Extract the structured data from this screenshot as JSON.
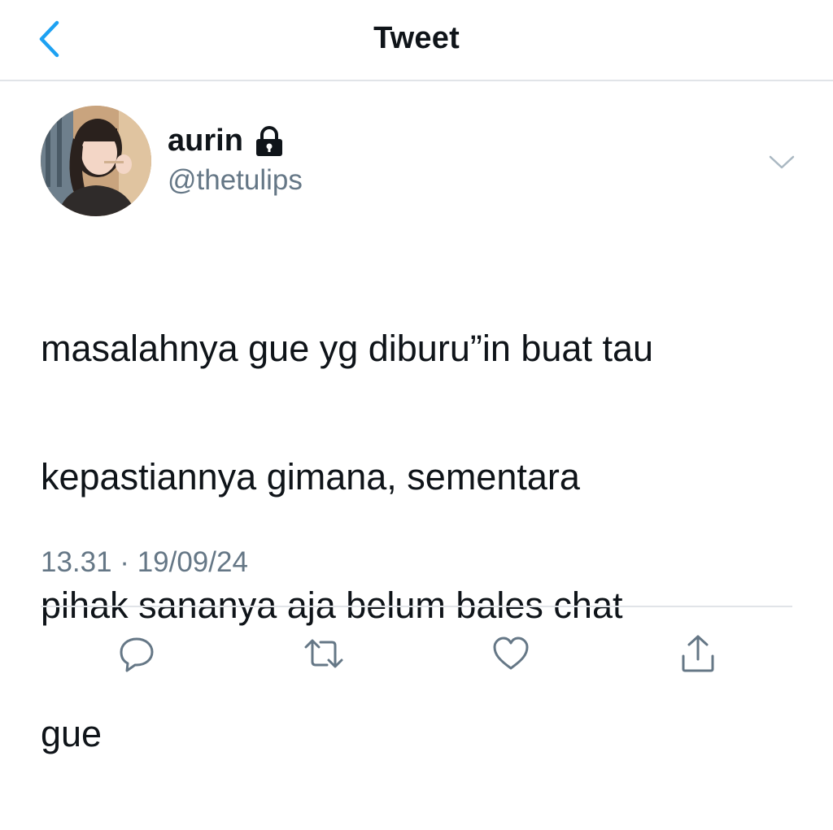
{
  "header": {
    "title": "Tweet",
    "back_icon": "chevron-left-icon"
  },
  "author": {
    "display_name": "aurin",
    "handle": "@thetulips",
    "protected_icon": "lock-icon"
  },
  "tweet": {
    "text_lines": [
      "masalahnya gue yg diburu”in buat tau",
      "kepastiannya gimana, sementara",
      "pihak sananya aja belum bales chat",
      "gue"
    ],
    "timestamp": "13.31 · 19/09/24"
  },
  "actions": {
    "icons": [
      "reply-icon",
      "retweet-icon",
      "like-icon",
      "share-icon"
    ]
  },
  "colors": {
    "accent": "#1da1f2",
    "secondary_text": "#657786",
    "icon_gray": "#657786",
    "divider": "#e1e4e8"
  }
}
